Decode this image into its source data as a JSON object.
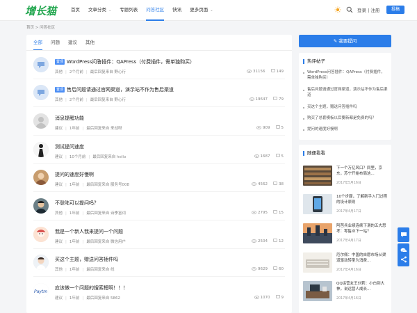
{
  "header": {
    "logo": "增长猫",
    "nav": [
      {
        "label": "首页"
      },
      {
        "label": "文章分类",
        "caret": "⌄"
      },
      {
        "label": "专题列表"
      },
      {
        "label": "问答社区",
        "active": true
      },
      {
        "label": "快讯"
      },
      {
        "label": "更多页面",
        "caret": "⌄"
      }
    ],
    "login": "登录 | 注册",
    "submit": "投稿",
    "icons": [
      "sun-icon",
      "search-icon"
    ]
  },
  "breadcrumb": "首页 > 问答社区",
  "tabs": [
    "全部",
    "问题",
    "建议",
    "其他"
  ],
  "questions": [
    {
      "pinned": true,
      "pin_label": "置顶",
      "title": "WordPress问答插件：QAPress（付费插件，需单独购买）",
      "category": "其他",
      "time": "2个月前",
      "last": "最后回复来自 野心行",
      "views": "31156",
      "comments": "149",
      "avatar": "bubble"
    },
    {
      "pinned": true,
      "pin_label": "置顶",
      "title": "售后问题请通过官网渠道，演示站不作为售后渠道",
      "category": "其他",
      "time": "2个月前",
      "last": "最后回复来自 野心行",
      "views": "19647",
      "comments": "79",
      "avatar": "bubble"
    },
    {
      "pinned": false,
      "title": "消息提醒功能",
      "category": "建议",
      "time": "1年前",
      "last": "最后回复来自 来战呀",
      "views": "909",
      "comments": "5",
      "avatar": "gray"
    },
    {
      "pinned": false,
      "title": "测试提问速度",
      "category": "建议",
      "time": "10个月前",
      "last": "最后回复来自 hello",
      "views": "1687",
      "comments": "5",
      "avatar": "silhouette"
    },
    {
      "pinned": false,
      "title": "提问的速度好慢啊",
      "category": "建议",
      "time": "1年前",
      "last": "最后回复来自 服务号008",
      "views": "4562",
      "comments": "38",
      "avatar": "photo"
    },
    {
      "pinned": false,
      "title": "不登陆可以提问吗？",
      "category": "其他",
      "time": "1年前",
      "last": "最后回复来自 诗季富词",
      "views": "2795",
      "comments": "15",
      "avatar": "man"
    },
    {
      "pinned": false,
      "title": "我是一个新人我来提问一个问题",
      "category": "建议",
      "time": "1年前",
      "last": "最后回复来自 微信用户",
      "views": "2504",
      "comments": "12",
      "avatar": "cartoon"
    },
    {
      "pinned": false,
      "title": "买这个主题，赠送问答插件吗",
      "category": "其他",
      "time": "1年前",
      "last": "最后回复来自 线",
      "views": "9629",
      "comments": "60",
      "avatar": "kid"
    },
    {
      "pinned": false,
      "title": "应该做一个问题的搜索框啊！！！",
      "category": "建议",
      "time": "1年前",
      "last": "最后回复来自 5862",
      "views": "1070",
      "comments": "9",
      "avatar": "logo"
    }
  ],
  "sidebar": {
    "ask_button": "我要提问",
    "hot_title": "热评帖子",
    "hot": [
      "WordPress问答插件：QAPress（付费插件，需单独购买）",
      "售后问题请通过官网渠道，演示站不作为售后渠道",
      "买这个主题，赠送问答插件吗",
      "购买了总套模板以后要新都是免费的吗？",
      "提问的速度好慢啊"
    ],
    "see_title": "随便看看",
    "see": [
      {
        "title": "下一个万亿风口？同里，京东，苏宁开始布局这...",
        "date": "2017年5月16日",
        "thumb": "library"
      },
      {
        "title": "10个步骤，了解新手入门过程的设计原则",
        "date": "2017年4月17日",
        "thumb": "phone"
      },
      {
        "title": "阿芭兵业绩连续下滑的五大思考：零售业下一站？",
        "date": "2017年4月17日",
        "thumb": "city"
      },
      {
        "title": "厄尔佩：中国的自愿市场从渠道驱动转型为消费...",
        "date": "2017年4月16日",
        "thumb": "keyboard"
      },
      {
        "title": "QQ运营女王刘莉：小白到大神，说运营人成长...",
        "date": "2017年4月16日",
        "thumb": "desk"
      }
    ]
  },
  "floating": [
    "chat-icon",
    "wechat-icon",
    "share-icon"
  ],
  "colors": {
    "accent": "#2b7de9",
    "logo": "#1fa54c",
    "background": "#f4f5f7"
  }
}
